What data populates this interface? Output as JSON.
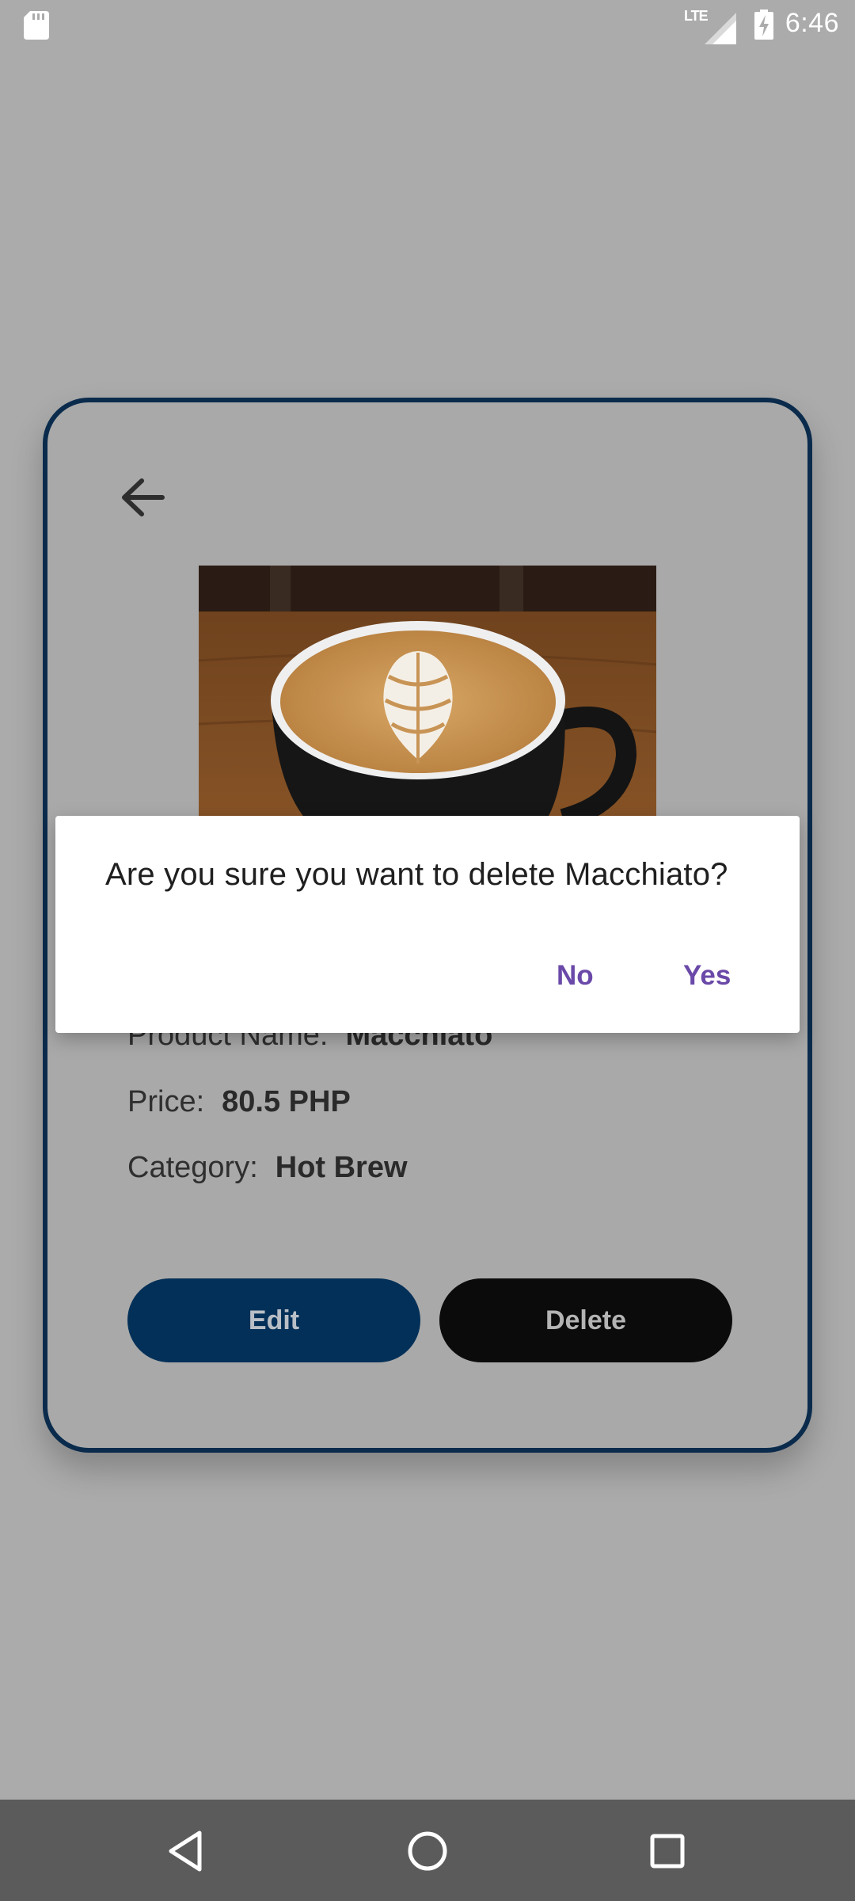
{
  "status_bar": {
    "time": "6:46",
    "network": "LTE",
    "icons": [
      "sd-card-icon",
      "signal-icon",
      "battery-charging-icon"
    ]
  },
  "product": {
    "name_label": "Product Name:",
    "name": "Macchiato",
    "price_label": "Price:",
    "price": "80.5 PHP",
    "category_label": "Category:",
    "category": "Hot Brew",
    "image": "latte-art-coffee-cup"
  },
  "actions": {
    "edit_label": "Edit",
    "delete_label": "Delete"
  },
  "dialog": {
    "message": "Are you sure you want to delete Macchiato?",
    "no_label": "No",
    "yes_label": "Yes"
  },
  "nav_bar": {
    "buttons": [
      "back-icon",
      "home-icon",
      "recents-icon"
    ]
  },
  "colors": {
    "card_border": "#0a2b4c",
    "edit_button": "#033058",
    "delete_button": "#0b0b0b",
    "dialog_accent": "#6a49a8",
    "scrim_background": "#ababab"
  }
}
